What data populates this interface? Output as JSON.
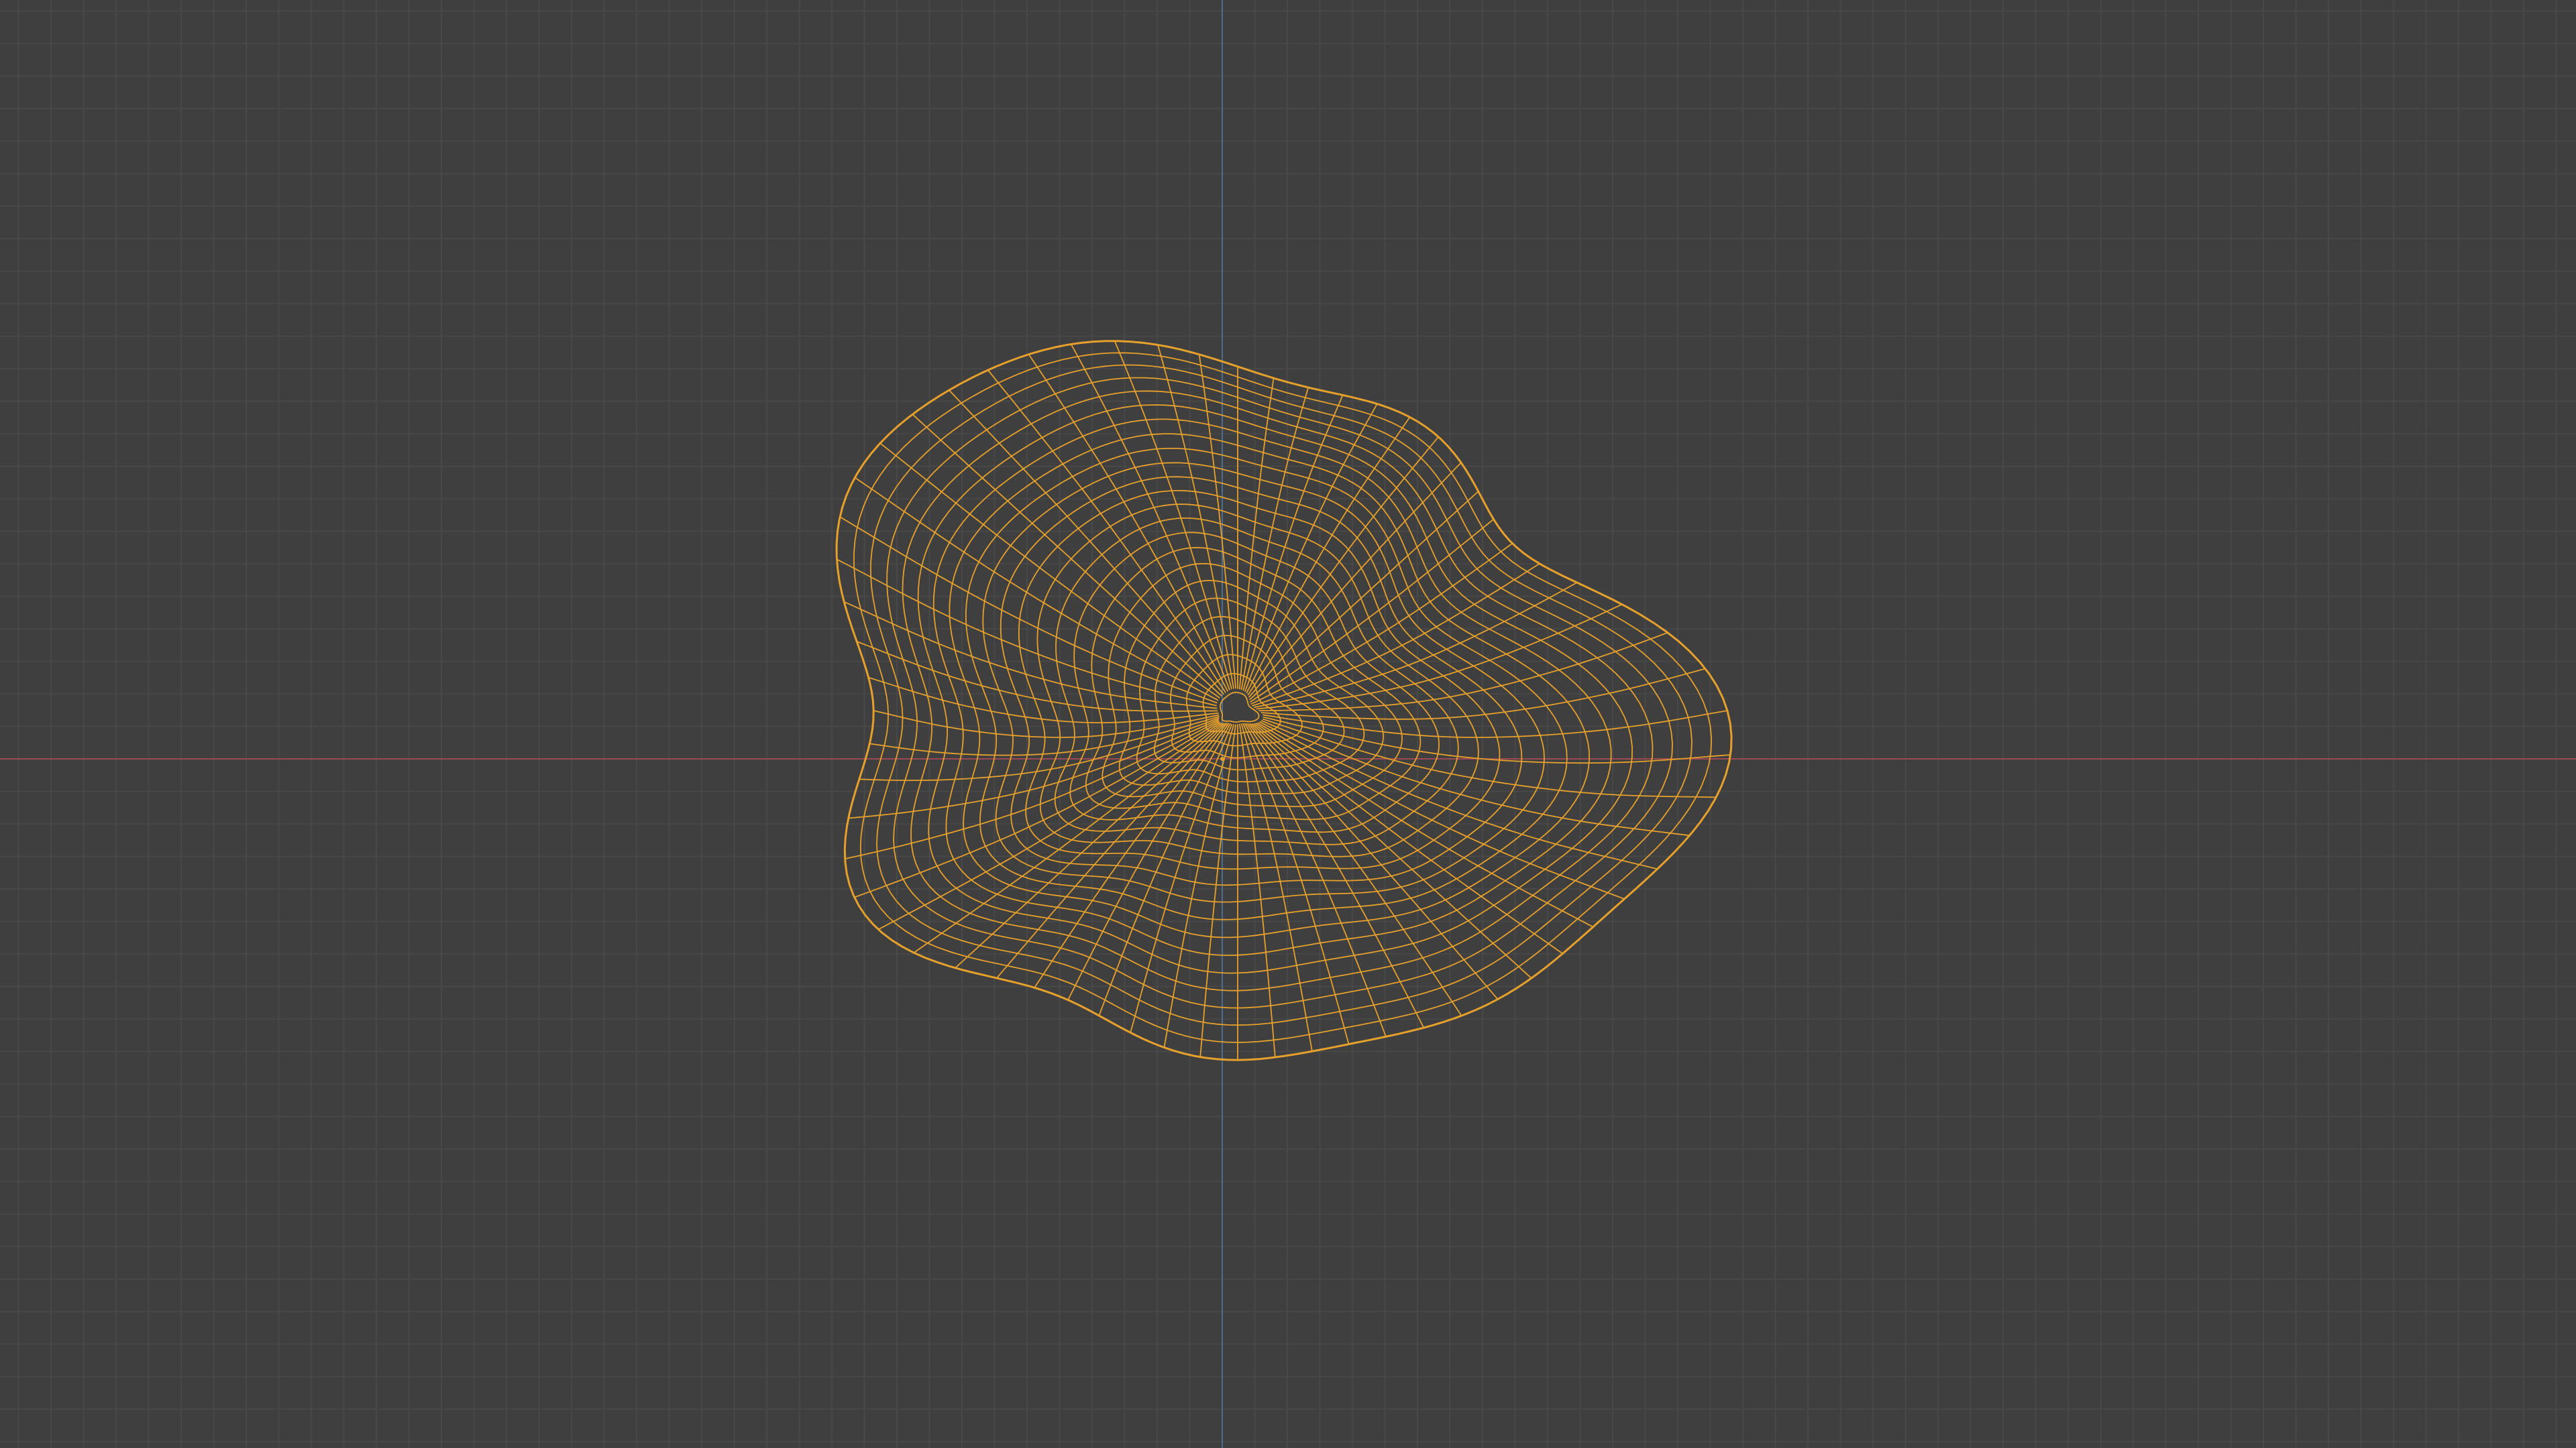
{
  "viewport": {
    "view_mode": "wireframe",
    "object_selected": true
  },
  "colors": {
    "background": "#3f3f3f",
    "grid_line": "#4a4a4a",
    "x_axis": "#9a4a52",
    "z_axis": "#4d6e8f",
    "wireframe_selected": "#e6a02c",
    "origin_point": "#e6a02c"
  },
  "scene": {
    "object": {
      "type": "mesh",
      "shape": "rock-like blob",
      "display": "wireframe"
    },
    "axes_visible": [
      "x",
      "z"
    ],
    "grid_visible": true
  }
}
